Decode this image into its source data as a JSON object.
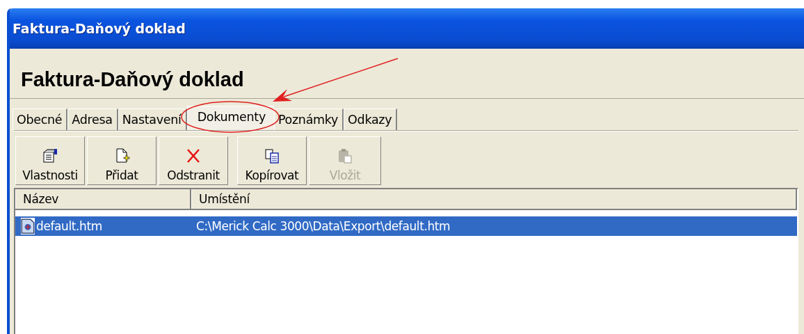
{
  "window": {
    "title": "Faktura-Daňový doklad"
  },
  "heading": "Faktura-Daňový doklad",
  "tabs": [
    {
      "label": "Obecné",
      "selected": false
    },
    {
      "label": "Adresa",
      "selected": false
    },
    {
      "label": "Nastavení",
      "selected": false
    },
    {
      "label": "Dokumenty",
      "selected": true
    },
    {
      "label": "Poznámky",
      "selected": false
    },
    {
      "label": "Odkazy",
      "selected": false
    }
  ],
  "toolbar": [
    {
      "label": "Vlastnosti",
      "kind": "properties",
      "disabled": false
    },
    {
      "label": "Přidat",
      "kind": "add",
      "disabled": false
    },
    {
      "label": "Odstranit",
      "kind": "delete",
      "disabled": false
    },
    {
      "label": "Kopírovat",
      "kind": "copy",
      "disabled": false
    },
    {
      "label": "Vložit",
      "kind": "paste",
      "disabled": true
    }
  ],
  "table": {
    "columns": [
      "Název",
      "Umístění"
    ],
    "rows": [
      {
        "cells": [
          "default.htm",
          "C:\\Merick Calc 3000\\Data\\Export\\default.htm"
        ],
        "selected": true
      }
    ]
  }
}
